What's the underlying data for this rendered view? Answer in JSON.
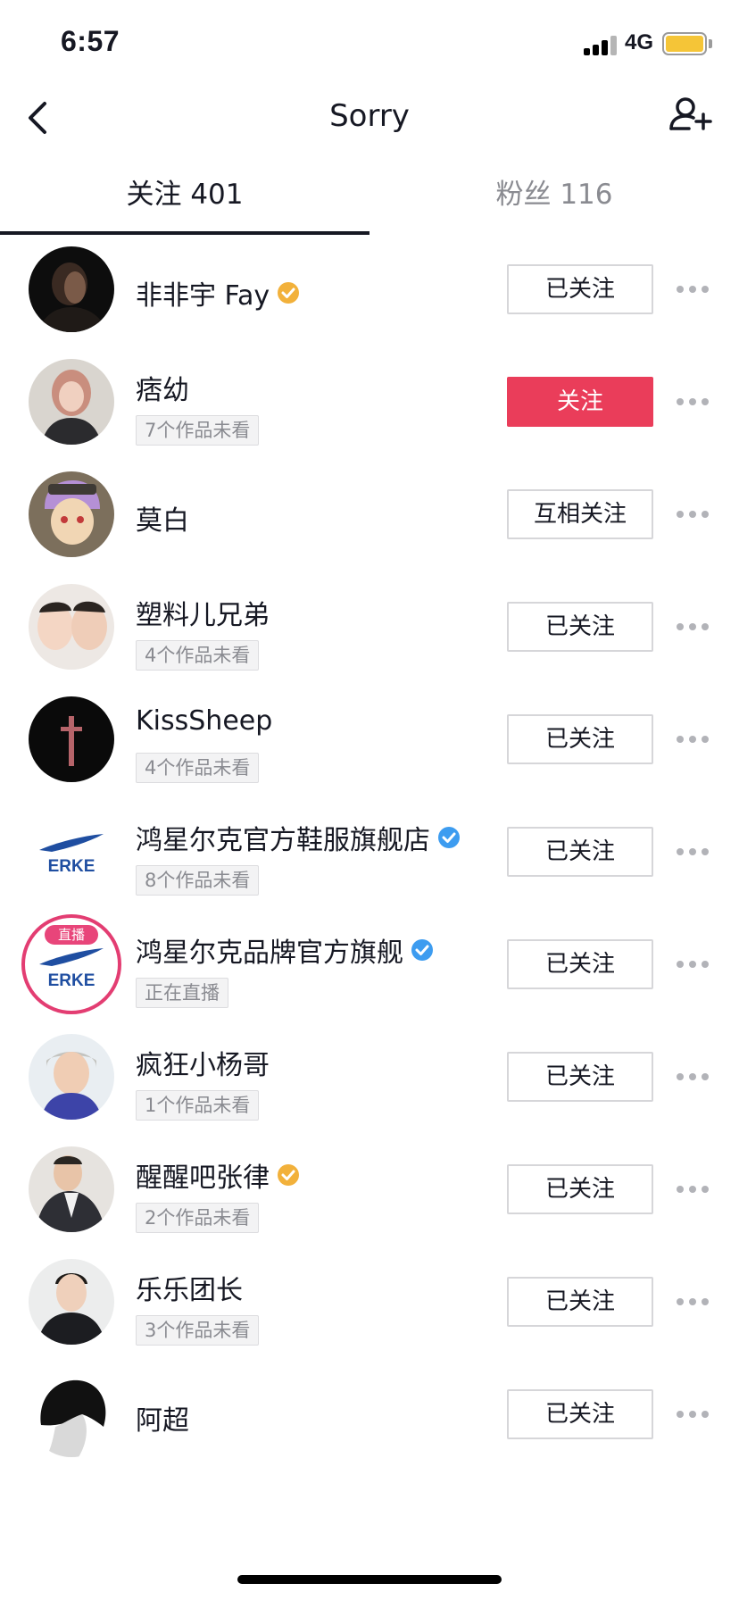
{
  "status_bar": {
    "time": "6:57",
    "network": "4G",
    "battery_color": "#f5c537"
  },
  "nav": {
    "title": "Sorry",
    "back_icon": "chevron-left-icon",
    "add_icon": "add-friend-icon"
  },
  "tabs": [
    {
      "label": "关注 401",
      "active": true
    },
    {
      "label": "粉丝 116",
      "active": false
    }
  ],
  "colors": {
    "accent": "#ea3d5a",
    "verified_gold": "#f2b13b",
    "verified_blue": "#3d9cf0",
    "live": "#e33d72"
  },
  "users": [
    {
      "name": "非非宇 Fay",
      "verified": "gold",
      "sub": "",
      "button": "已关注",
      "button_primary": false
    },
    {
      "name": "痞幼",
      "verified": "",
      "sub": "7个作品未看",
      "button": "关注",
      "button_primary": true
    },
    {
      "name": "莫白",
      "verified": "",
      "sub": "",
      "button": "互相关注",
      "button_primary": false
    },
    {
      "name": "塑料儿兄弟",
      "verified": "",
      "sub": "4个作品未看",
      "button": "已关注",
      "button_primary": false
    },
    {
      "name": "KissSheep",
      "verified": "",
      "sub": "4个作品未看",
      "button": "已关注",
      "button_primary": false
    },
    {
      "name": "鸿星尔克官方鞋服旗舰店",
      "verified": "blue",
      "sub": "8个作品未看",
      "button": "已关注",
      "button_primary": false,
      "logo_text": "ERKE"
    },
    {
      "name": "鸿星尔克品牌官方旗舰",
      "verified": "blue",
      "sub": "正在直播",
      "button": "已关注",
      "button_primary": false,
      "logo_text": "ERKE",
      "live_tag": "直播"
    },
    {
      "name": "疯狂小杨哥",
      "verified": "",
      "sub": "1个作品未看",
      "button": "已关注",
      "button_primary": false
    },
    {
      "name": "醒醒吧张律",
      "verified": "gold",
      "sub": "2个作品未看",
      "button": "已关注",
      "button_primary": false
    },
    {
      "name": "乐乐团长",
      "verified": "",
      "sub": "3个作品未看",
      "button": "已关注",
      "button_primary": false
    },
    {
      "name": "阿超",
      "verified": "",
      "sub": "",
      "button": "已关注",
      "button_primary": false
    }
  ]
}
